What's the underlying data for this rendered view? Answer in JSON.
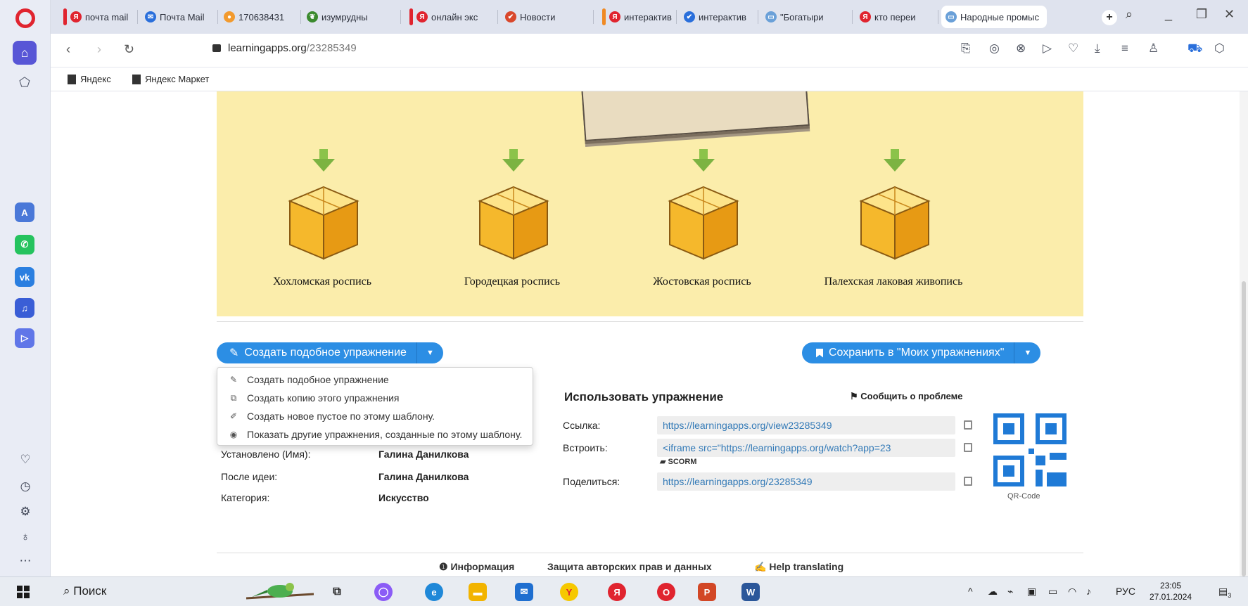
{
  "browser": {
    "tabs": [
      {
        "label": "почта mail",
        "color": "#e0242f",
        "fav": "Я",
        "favbg": "#e0242f"
      },
      {
        "label": "Почта Mail",
        "color": "",
        "fav": "✉",
        "favbg": "#2a6fdb"
      },
      {
        "label": "170638431",
        "color": "",
        "fav": "●",
        "favbg": "#f29a2e"
      },
      {
        "label": "изумрудны",
        "color": "",
        "fav": "❦",
        "favbg": "#3b8a2e"
      },
      {
        "label": "онлайн экс",
        "color": "#e0242f",
        "fav": "Я",
        "favbg": "#e0242f"
      },
      {
        "label": "Новости",
        "color": "",
        "fav": "✔",
        "favbg": "#d9472b"
      },
      {
        "label": "интерактив",
        "color": "#f08a24",
        "fav": "Я",
        "favbg": "#e0242f"
      },
      {
        "label": "интерактив",
        "color": "",
        "fav": "✔",
        "favbg": "#2a6fdb"
      },
      {
        "label": "\"Богатыри",
        "color": "",
        "fav": "▭",
        "favbg": "#6aa0d8"
      },
      {
        "label": "кто переи",
        "color": "",
        "fav": "Я",
        "favbg": "#e0242f"
      },
      {
        "label": "Народные промыс",
        "color": "",
        "fav": "▭",
        "favbg": "#6aa0d8",
        "active": true
      }
    ],
    "new_tab": "+",
    "url_host": "learningapps.org",
    "url_path": "/23285349",
    "bookmarks": [
      "Яндекс",
      "Яндекс Маркет"
    ]
  },
  "app": {
    "categories": [
      "Хохломская роспись",
      "Городецкая роспись",
      "Жостовская роспись",
      "Палехская лаковая живопись"
    ]
  },
  "actions": {
    "create_label": "Создать подобное упражнение",
    "save_label": "Сохранить в \"Моих упражнениях\""
  },
  "dropdown": [
    {
      "icon": "✎",
      "label": "Создать подобное упражнение"
    },
    {
      "icon": "⧉",
      "label": "Создать копию этого упражнения"
    },
    {
      "icon": "✐",
      "label": "Создать новое пустое по этому шаблону."
    },
    {
      "icon": "◉",
      "label": "Показать другие упражнения, созданные по этому шаблону."
    }
  ],
  "info": [
    {
      "key": "Установлено (Имя):",
      "value": "Галина Данилкова"
    },
    {
      "key": "После идеи:",
      "value": "Галина Данилкова"
    },
    {
      "key": "Категория:",
      "value": "Искусство"
    }
  ],
  "use": {
    "title": "Использовать упражнение",
    "report": "Сообщить о проблеме",
    "link_label": "Ссылка:",
    "link_value": "https://learningapps.org/view23285349",
    "embed_label": "Встроить:",
    "embed_value": "<iframe src=\"https://learningapps.org/watch?app=23",
    "scorm": "SCORM",
    "share_label": "Поделиться:",
    "share_value": "https://learningapps.org/23285349",
    "qr_caption": "QR-Code"
  },
  "footer": {
    "info": "Информация",
    "copyright": "Защита авторских прав и данных",
    "translate": "Help translating"
  },
  "taskbar": {
    "search": "Поиск",
    "lang": "РУС",
    "time": "23:05",
    "date": "27.01.2024",
    "notif": "3"
  }
}
